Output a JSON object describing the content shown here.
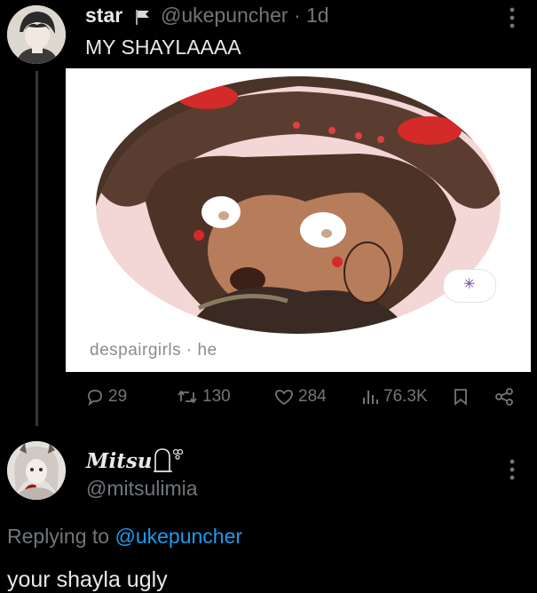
{
  "tweet": {
    "author_name": "star",
    "handle_time": "@ukepuncher · 1d",
    "text": "MY SHAYLAAAA",
    "media_caption": "despairgirls · he",
    "stats": {
      "replies": "29",
      "reposts": "130",
      "likes": "284",
      "views": "76.3K"
    }
  },
  "reply": {
    "author_name": "Mitsu",
    "handle": "@mitsulimia",
    "replying_prefix": "Replying to ",
    "replying_to": "@ukepuncher",
    "text": "your shayla ugly"
  },
  "icons": {
    "flag": "flag-icon",
    "more": "more-vertical-icon",
    "reply": "reply-icon",
    "repost": "repost-icon",
    "like": "heart-icon",
    "views": "views-icon",
    "bookmark": "bookmark-icon",
    "share": "share-icon",
    "tombstone": "tombstone-icon",
    "spider": "spider-icon"
  },
  "colors": {
    "background": "#000000",
    "text_primary": "#e7e9ea",
    "text_secondary": "#71767b",
    "link": "#1d9bf0",
    "thread_line": "#333639"
  }
}
